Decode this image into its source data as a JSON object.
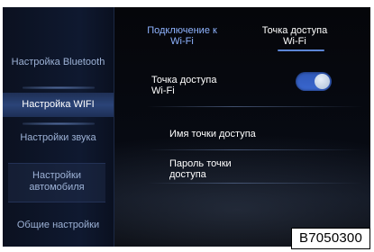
{
  "sidebar": {
    "items": [
      {
        "label": "Настройка Bluetooth"
      },
      {
        "label": "Настройка WIFI"
      },
      {
        "label": "Настройки звука"
      },
      {
        "label": "Настройки автомобиля"
      },
      {
        "label": "Общие настройки"
      }
    ],
    "active_index": 1
  },
  "tabs": [
    {
      "label": "Подключение к Wi-Fi",
      "active": false
    },
    {
      "label": "Точка доступа Wi-Fi",
      "active": true
    }
  ],
  "main": {
    "hotspot_toggle": {
      "label": "Точка доступа Wi-Fi",
      "on": true
    },
    "hotspot_name": {
      "label": "Имя точки доступа"
    },
    "hotspot_password": {
      "label": "Пароль точки доступа"
    }
  },
  "code_label": "B7050300",
  "colors": {
    "accent": "#3a67cf",
    "tab_inactive": "#8fb3ff",
    "sidebar_text": "#9db2d6"
  }
}
